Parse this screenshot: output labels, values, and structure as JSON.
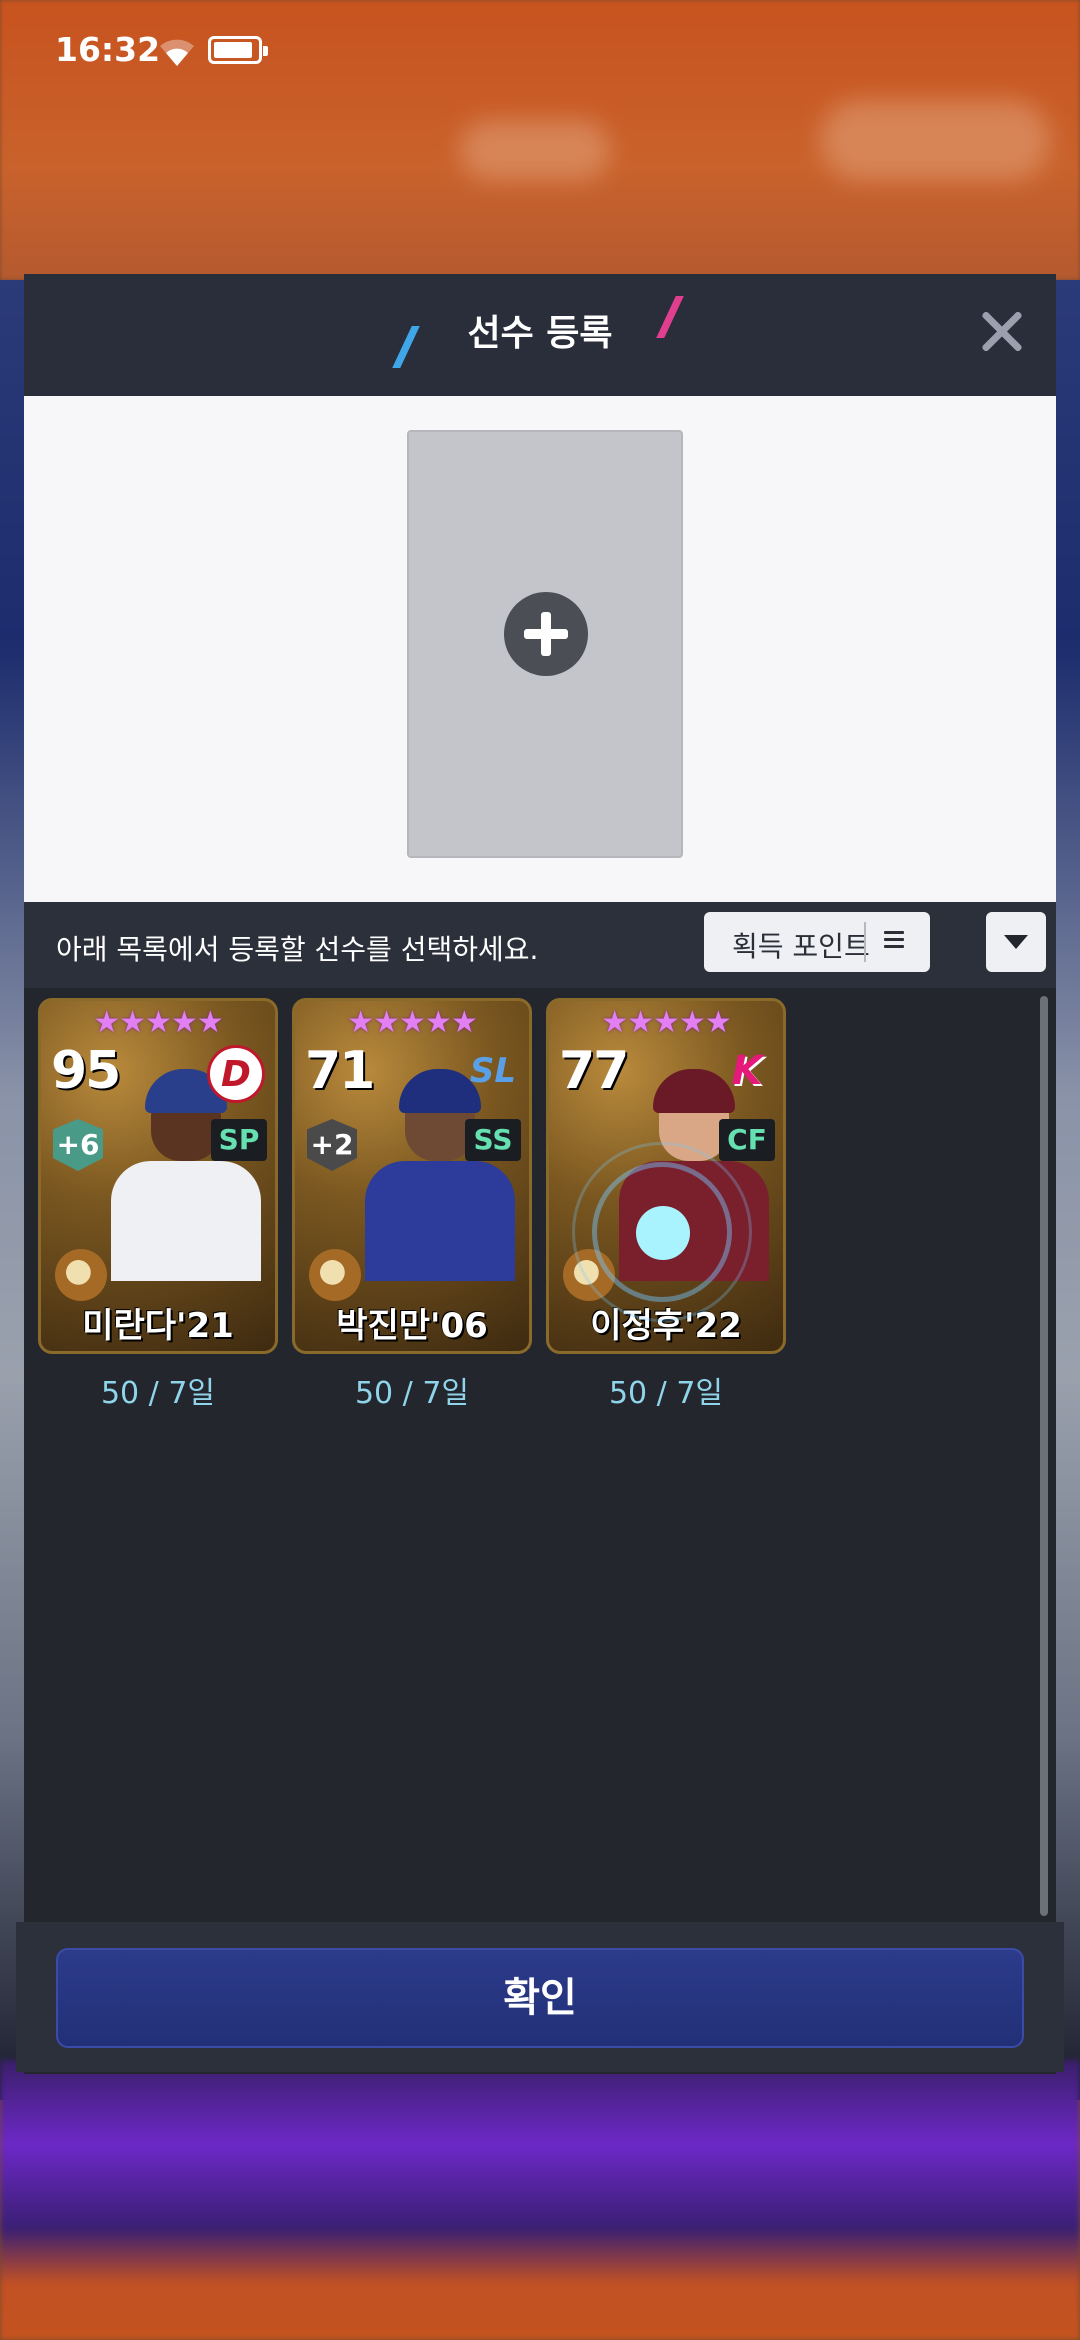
{
  "status_bar": {
    "time": "16:32",
    "icons": [
      "wifi-icon",
      "battery-icon"
    ]
  },
  "dialog": {
    "title": "선수 등록",
    "instruction": "아래 목록에서 등록할 선수를 선택하세요.",
    "sort": {
      "label": "획득 포인트"
    },
    "confirm_label": "확인"
  },
  "players": [
    {
      "name": "미란다'21",
      "ovr": "95",
      "position": "SP",
      "boost": "+6",
      "team_logo": "D",
      "meta": "50 / 7일",
      "stars": "★★★★★"
    },
    {
      "name": "박진만'06",
      "ovr": "71",
      "position": "SS",
      "boost": "+2",
      "team_logo": "SL",
      "meta": "50 / 7일",
      "stars": "★★★★★"
    },
    {
      "name": "이정후'22",
      "ovr": "77",
      "position": "CF",
      "boost": "",
      "team_logo": "K",
      "meta": "50 / 7일",
      "stars": "★★★★★"
    }
  ],
  "colors": {
    "accent": "#223078",
    "star": "#e27ff2",
    "meta_text": "#8fd4ea"
  }
}
